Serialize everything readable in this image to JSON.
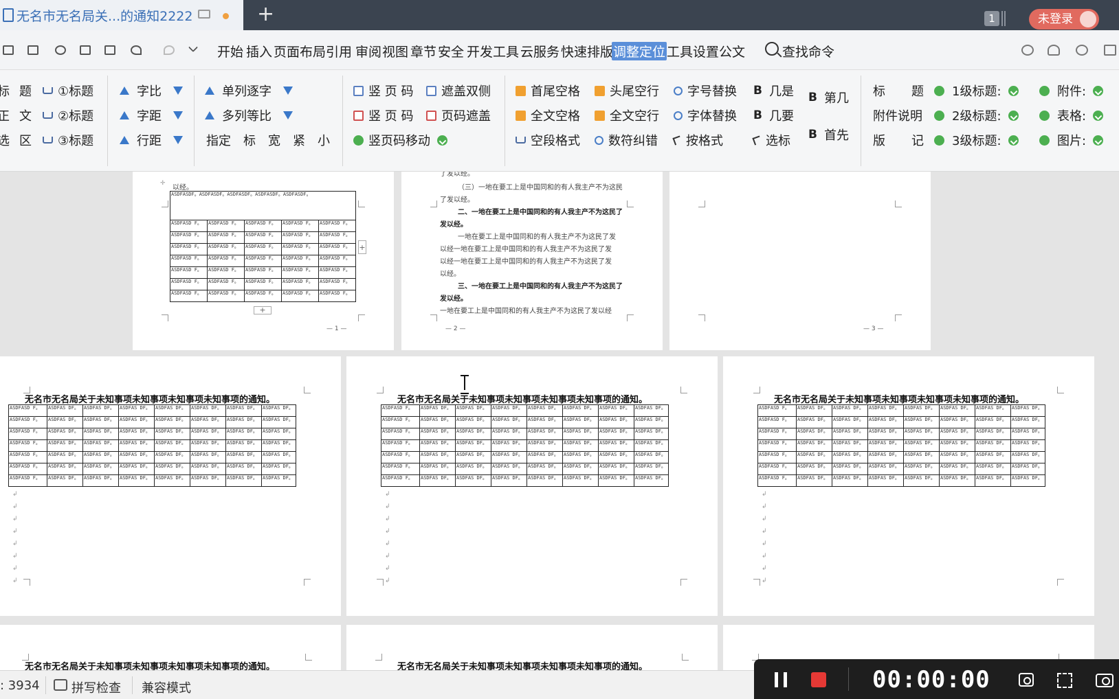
{
  "tab": {
    "title": "无名市无名局关...的通知2222"
  },
  "window": {
    "badge": "1",
    "login": "未登录"
  },
  "menu": {
    "items": [
      "开始",
      "插入",
      "页面布局",
      "引用",
      "审阅",
      "视图",
      "章节",
      "安全",
      "开发工具",
      "云服务",
      "快速排版",
      "调整定位",
      "工具设置",
      "公文"
    ],
    "active_index": 11,
    "search": "查找命令"
  },
  "ribbon": {
    "g1": [
      {
        "l": "标",
        "r": "题",
        "h": "①标题"
      },
      {
        "l": "正",
        "r": "文",
        "h": "②标题"
      },
      {
        "l": "选",
        "r": "区",
        "h": "③标题"
      }
    ],
    "g2": [
      "字比",
      "字距",
      "行距"
    ],
    "g3": {
      "r1": "单列逐字",
      "r2": "多列等比",
      "r3": [
        "指定",
        "标",
        "宽",
        "紧",
        "小"
      ]
    },
    "g4": {
      "a": "竖 页 码",
      "b": "遮盖双侧",
      "c": "竖 页 码",
      "d": "页码遮盖",
      "e": "竖页码移动"
    },
    "g5": [
      [
        "首尾空格",
        "头尾空行",
        "字号替换",
        "几是"
      ],
      [
        "全文空格",
        "全文空行",
        "字体替换",
        "几要"
      ],
      [
        "空段格式",
        "数符纠错",
        "按格式",
        "选标"
      ]
    ],
    "g5b": [
      "B",
      "B",
      "B",
      "B",
      "B",
      "B"
    ],
    "g6": [
      "第几",
      "首先"
    ],
    "g7": [
      [
        "标",
        "题"
      ],
      [
        "附件说明",
        ""
      ],
      [
        "版",
        "记"
      ]
    ],
    "g8": [
      "1级标题:",
      "2级标题:",
      "3级标题:"
    ],
    "g9": [
      "附件:",
      "表格:",
      "图片:"
    ]
  },
  "pages": {
    "p1": {
      "head": "以经。",
      "merged": "ASDFASDF。ASDFASDF。ASDFASDF。ASDFASDF。ASDFASDF。",
      "cell": "ASDFASD F。",
      "num": "— 1 —"
    },
    "p2": {
      "lines": [
        {
          "t": "了发以经。",
          "b": false
        },
        {
          "t": "（三）一地在要工上是中国同和的有人我主产不为这民",
          "b": false
        },
        {
          "t": "了发以经。",
          "b": false
        },
        {
          "t": "二、一地在要工上是中国同和的有人我主产不为这民了",
          "b": true
        },
        {
          "t": "发以经。",
          "b": true
        },
        {
          "t": "一地在要工上是中国同和的有人我主产不为这民了发",
          "b": false
        },
        {
          "t": "以经一地在要工上是中国同和的有人我主产不为这民了发",
          "b": false
        },
        {
          "t": "以经一地在要工上是中国同和的有人我主产不为这民了发",
          "b": false
        },
        {
          "t": "以经。",
          "b": false
        },
        {
          "t": "三、一地在要工上是中国同和的有人我主产不为这民了",
          "b": true
        },
        {
          "t": "发以经。",
          "b": true
        },
        {
          "t": "一地在要工上是中国同和的有人我主产不为这民了发以经",
          "b": false
        }
      ],
      "num": "— 2 —"
    },
    "p3": {
      "num": "— 3 —"
    },
    "title": "无名市无名局关于未知事项未知事项未知事项未知事项的通知。",
    "cell_a": "ASDFASD F。",
    "cell_b": "ASDFAS DF。"
  },
  "status": {
    "words": ": 3934",
    "spell": "拼写检查",
    "compat": "兼容模式"
  },
  "recorder": {
    "time": "00:00:00"
  }
}
